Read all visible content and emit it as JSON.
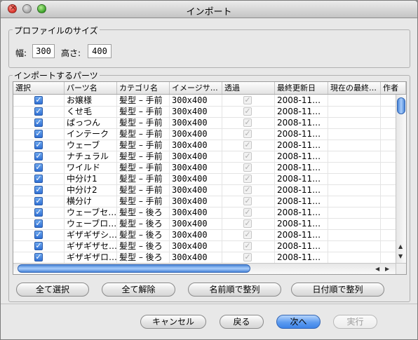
{
  "window": {
    "title": "インポート"
  },
  "profile_size": {
    "legend": "プロファイルのサイズ",
    "width_label": "幅:",
    "width_value": "300",
    "height_label": "高さ:",
    "height_value": "400"
  },
  "parts": {
    "legend": "インポートするパーツ",
    "columns": [
      "選択",
      "パーツ名",
      "カテゴリ名",
      "イメージサ…",
      "透過",
      "最終更新日",
      "現在の最終…",
      "作者"
    ],
    "rows": [
      {
        "name": "お嬢様",
        "category": "髪型 – 手前",
        "size": "300x400",
        "date": "2008-11…",
        "selected": true,
        "transparent": true
      },
      {
        "name": "くせ毛",
        "category": "髪型 – 手前",
        "size": "300x400",
        "date": "2008-11…",
        "selected": true,
        "transparent": true
      },
      {
        "name": "ぱっつん",
        "category": "髪型 – 手前",
        "size": "300x400",
        "date": "2008-11…",
        "selected": true,
        "transparent": true
      },
      {
        "name": "インテーク",
        "category": "髪型 – 手前",
        "size": "300x400",
        "date": "2008-11…",
        "selected": true,
        "transparent": true
      },
      {
        "name": "ウェーブ",
        "category": "髪型 – 手前",
        "size": "300x400",
        "date": "2008-11…",
        "selected": true,
        "transparent": true
      },
      {
        "name": "ナチュラル",
        "category": "髪型 – 手前",
        "size": "300x400",
        "date": "2008-11…",
        "selected": true,
        "transparent": true
      },
      {
        "name": "ワイルド",
        "category": "髪型 – 手前",
        "size": "300x400",
        "date": "2008-11…",
        "selected": true,
        "transparent": true
      },
      {
        "name": "中分け1",
        "category": "髪型 – 手前",
        "size": "300x400",
        "date": "2008-11…",
        "selected": true,
        "transparent": true
      },
      {
        "name": "中分け2",
        "category": "髪型 – 手前",
        "size": "300x400",
        "date": "2008-11…",
        "selected": true,
        "transparent": true
      },
      {
        "name": "横分け",
        "category": "髪型 – 手前",
        "size": "300x400",
        "date": "2008-11…",
        "selected": true,
        "transparent": true
      },
      {
        "name": "ウェーブセ…",
        "category": "髪型 – 後ろ",
        "size": "300x400",
        "date": "2008-11…",
        "selected": true,
        "transparent": true
      },
      {
        "name": "ウェーブロ…",
        "category": "髪型 – 後ろ",
        "size": "300x400",
        "date": "2008-11…",
        "selected": true,
        "transparent": true
      },
      {
        "name": "ギザギザシ…",
        "category": "髪型 – 後ろ",
        "size": "300x400",
        "date": "2008-11…",
        "selected": true,
        "transparent": true
      },
      {
        "name": "ギザギザセ…",
        "category": "髪型 – 後ろ",
        "size": "300x400",
        "date": "2008-11…",
        "selected": true,
        "transparent": true
      },
      {
        "name": "ギザギザロ…",
        "category": "髪型 – 後ろ",
        "size": "300x400",
        "date": "2008-11…",
        "selected": true,
        "transparent": true
      }
    ]
  },
  "actions": {
    "select_all": "全て選択",
    "deselect_all": "全て解除",
    "sort_by_name": "名前順で整列",
    "sort_by_date": "日付順で整列"
  },
  "footer": {
    "cancel": "キャンセル",
    "back": "戻る",
    "next": "次へ",
    "execute": "実行"
  },
  "icons": {
    "checkbox_checked": "checkmark-icon",
    "scroll_up": "arrow-up-icon",
    "scroll_down": "arrow-down-icon",
    "scroll_left": "arrow-left-icon",
    "scroll_right": "arrow-right-icon"
  }
}
